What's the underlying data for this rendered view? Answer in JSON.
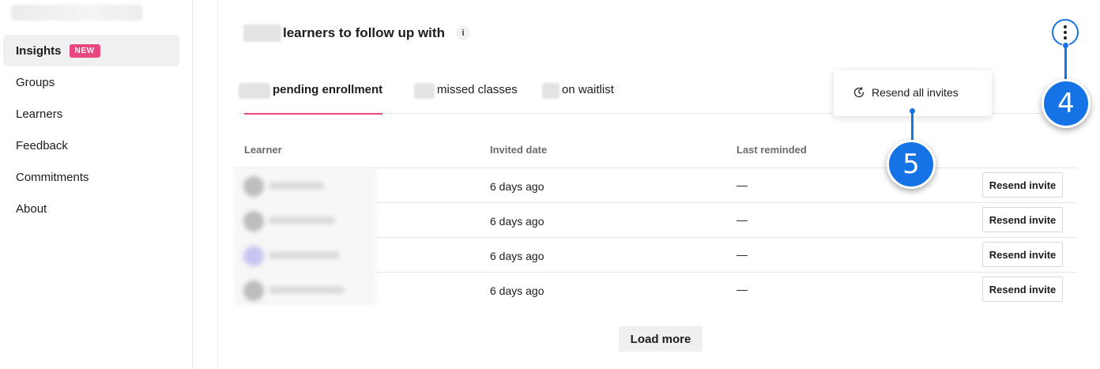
{
  "sidebar": {
    "items": [
      {
        "label": "Insights",
        "badge": "NEW",
        "active": true
      },
      {
        "label": "Groups"
      },
      {
        "label": "Learners"
      },
      {
        "label": "Feedback"
      },
      {
        "label": "Commitments"
      },
      {
        "label": "About"
      }
    ]
  },
  "header": {
    "title_suffix": "learners to follow up with",
    "info_icon": "i"
  },
  "tabs": [
    {
      "label": "pending enrollment",
      "active": true
    },
    {
      "label": "missed classes"
    },
    {
      "label": "on waitlist"
    }
  ],
  "table": {
    "columns": [
      "Learner",
      "Invited date",
      "Last reminded"
    ],
    "rows": [
      {
        "invited": "6 days ago",
        "reminded": "—",
        "action": "Resend invite"
      },
      {
        "invited": "6 days ago",
        "reminded": "—",
        "action": "Resend invite"
      },
      {
        "invited": "6 days ago",
        "reminded": "—",
        "action": "Resend invite"
      },
      {
        "invited": "6 days ago",
        "reminded": "—",
        "action": "Resend invite"
      }
    ]
  },
  "load_more": "Load more",
  "menu": {
    "items": [
      {
        "label": "Resend all invites",
        "icon": "clock-refresh-icon"
      }
    ]
  },
  "callouts": [
    "4",
    "5"
  ],
  "colors": {
    "accent_pink": "#e8487e",
    "callout_blue": "#1673e6"
  }
}
